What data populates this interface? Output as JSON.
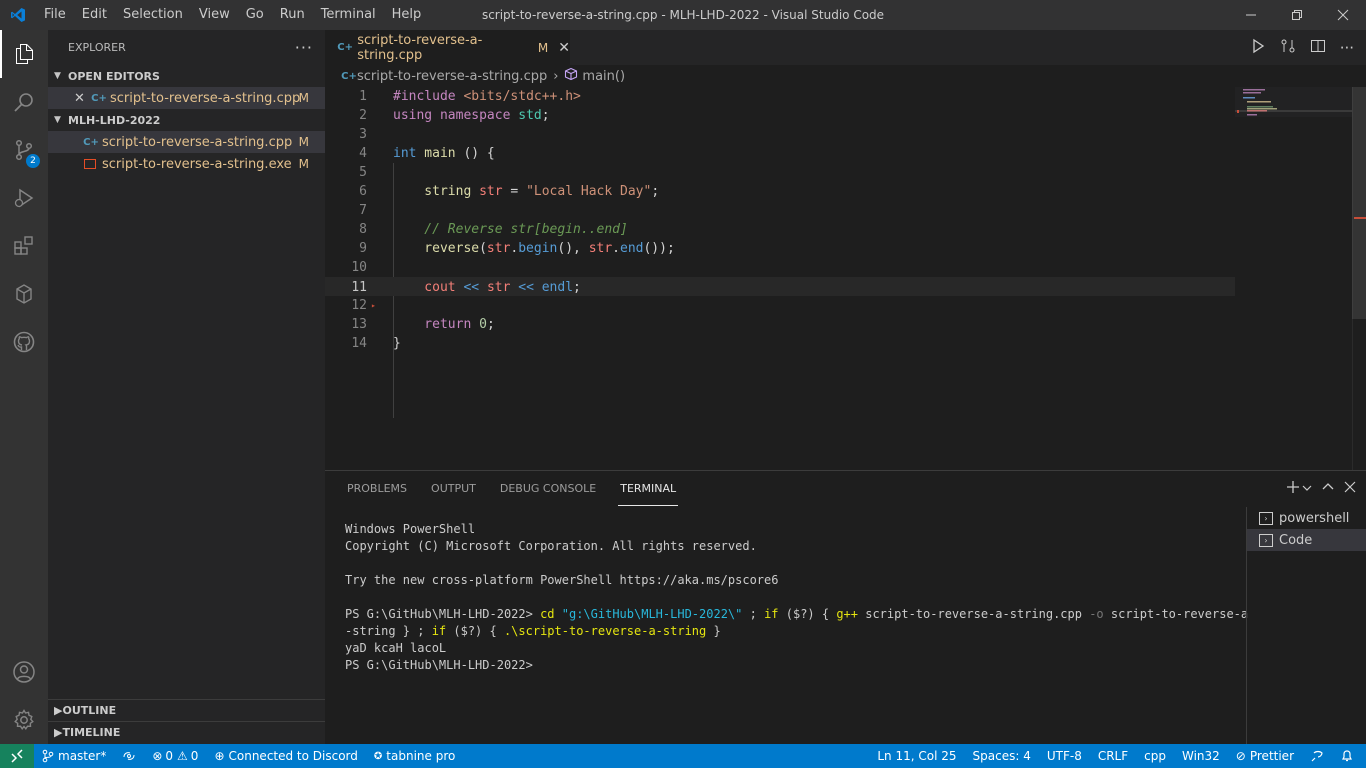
{
  "window": {
    "title": "script-to-reverse-a-string.cpp - MLH-LHD-2022 - Visual Studio Code",
    "menu": [
      "File",
      "Edit",
      "Selection",
      "View",
      "Go",
      "Run",
      "Terminal",
      "Help"
    ]
  },
  "activity": {
    "source_control_badge": "2"
  },
  "sidebar": {
    "title": "EXPLORER",
    "open_editors_label": "OPEN EDITORS",
    "open_editors": [
      {
        "name": "script-to-reverse-a-string.cpp",
        "status": "M"
      }
    ],
    "folder_label": "MLH-LHD-2022",
    "files": [
      {
        "name": "script-to-reverse-a-string.cpp",
        "status": "M"
      },
      {
        "name": "script-to-reverse-a-string.exe",
        "status": "M"
      }
    ],
    "outline_label": "OUTLINE",
    "timeline_label": "TIMELINE"
  },
  "tab": {
    "label": "script-to-reverse-a-string.cpp",
    "status": "M"
  },
  "breadcrumb": {
    "file": "script-to-reverse-a-string.cpp",
    "symbol": "main()"
  },
  "editor": {
    "current_line": 11,
    "line_numbers": [
      "1",
      "2",
      "3",
      "4",
      "5",
      "6",
      "7",
      "8",
      "9",
      "10",
      "11",
      "12",
      "13",
      "14"
    ],
    "code": {
      "l1_kw": "#include",
      "l1_path": " <bits/stdc++.h>",
      "l2_a": "using",
      "l2_b": " namespace",
      "l2_c": " std",
      "l2_d": ";",
      "l4_a": "int",
      "l4_b": " main",
      "l4_c": " () {",
      "l6_a": "    string",
      "l6_b": " str",
      "l6_c": " = ",
      "l6_d": "\"Local Hack Day\"",
      "l6_e": ";",
      "l8": "    // Reverse str[begin..end]",
      "l9_a": "    reverse",
      "l9_b": "(",
      "l9_c": "str",
      "l9_d": ".",
      "l9_e": "begin",
      "l9_f": "(), ",
      "l9_g": "str",
      "l9_h": ".",
      "l9_i": "end",
      "l9_j": "());",
      "l11_a": "    cout",
      "l11_b": " << ",
      "l11_c": "str",
      "l11_d": " << ",
      "l11_e": "endl",
      "l11_f": ";",
      "l13_a": "    return",
      "l13_b": " 0",
      "l13_c": ";",
      "l14": "}"
    }
  },
  "panel": {
    "tabs": [
      "PROBLEMS",
      "OUTPUT",
      "DEBUG CONSOLE",
      "TERMINAL"
    ],
    "active_tab": "TERMINAL",
    "terminal": {
      "l1": "Windows PowerShell",
      "l2": "Copyright (C) Microsoft Corporation. All rights reserved.",
      "l3": "Try the new cross-platform PowerShell https://aka.ms/pscore6",
      "prompt": "PS G:\\GitHub\\MLH-LHD-2022> ",
      "cmd_cd": "cd",
      "cmd_path": " \"g:\\GitHub\\MLH-LHD-2022\\\"",
      "cmd_mid1": " ; ",
      "cmd_if1": "if",
      "cmd_cond1": " ($?) { ",
      "cmd_gpp": "g++",
      "cmd_file": " script-to-reverse-a-string.cpp ",
      "cmd_o": "-o",
      "cmd_out": " script-to-reverse-a",
      "cmd_wrap": "-string } ; ",
      "cmd_if2": "if",
      "cmd_cond2": " ($?) { ",
      "cmd_run": ".\\script-to-reverse-a-string",
      "cmd_end": " }",
      "output": "yaD kcaH lacoL",
      "prompt2": "PS G:\\GitHub\\MLH-LHD-2022>"
    },
    "terminal_list": [
      "powershell",
      "Code"
    ]
  },
  "status": {
    "branch": "master*",
    "errors": "0",
    "warnings": "0",
    "discord": "Connected to Discord",
    "tabnine": "tabnine pro",
    "position": "Ln 11, Col 25",
    "spaces": "Spaces: 4",
    "encoding": "UTF-8",
    "eol": "CRLF",
    "language": "cpp",
    "platform": "Win32",
    "prettier": "Prettier"
  },
  "colors": {
    "accent": "#007acc",
    "modified": "#e2c08d",
    "remote": "#16825d"
  }
}
